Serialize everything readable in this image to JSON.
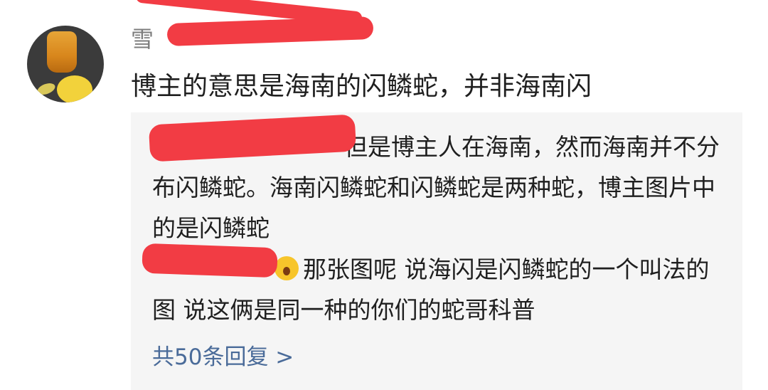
{
  "comment": {
    "username": "雪",
    "text": "博主的意思是海南的闪鳞蛇，并非海南闪"
  },
  "replies": [
    {
      "text": "但是博主人在海南，然而海南并不分布闪鳞蛇。海南闪鳞蛇和闪鳞蛇是两种蛇，博主图片中的是闪鳞蛇"
    },
    {
      "emoji": "scared-face-emoji",
      "text": "那张图呢 说海闪是闪鳞蛇的一个叫法的图 说这俩是同一种的你们的蛇哥科普"
    }
  ],
  "more_replies_label": "共50条回复 >",
  "colors": {
    "link": "#4a6b99",
    "reply_bg": "#f5f5f5",
    "redaction": "#f23c44"
  }
}
